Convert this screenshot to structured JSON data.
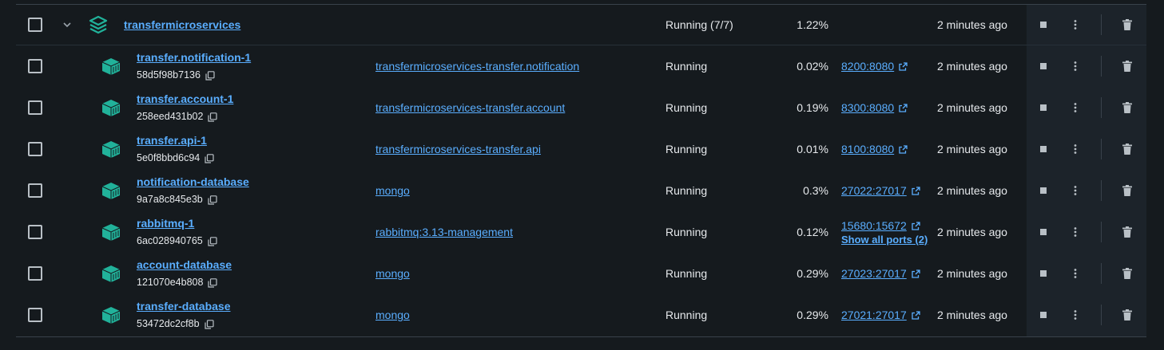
{
  "group": {
    "name": "transfermicroservices",
    "status": "Running (7/7)",
    "cpu": "1.22%",
    "started": "2 minutes ago"
  },
  "containers": [
    {
      "name": "transfer.notification-1",
      "id": "58d5f98b7136",
      "image": "transfermicroservices-transfer.notification",
      "status": "Running",
      "cpu": "0.02%",
      "ports": [
        "8200:8080"
      ],
      "started": "2 minutes ago"
    },
    {
      "name": "transfer.account-1",
      "id": "258eed431b02",
      "image": "transfermicroservices-transfer.account",
      "status": "Running",
      "cpu": "0.19%",
      "ports": [
        "8300:8080"
      ],
      "started": "2 minutes ago"
    },
    {
      "name": "transfer.api-1",
      "id": "5e0f8bbd6c94",
      "image": "transfermicroservices-transfer.api",
      "status": "Running",
      "cpu": "0.01%",
      "ports": [
        "8100:8080"
      ],
      "started": "2 minutes ago"
    },
    {
      "name": "notification-database",
      "id": "9a7a8c845e3b",
      "image": "mongo",
      "status": "Running",
      "cpu": "0.3%",
      "ports": [
        "27022:27017"
      ],
      "started": "2 minutes ago"
    },
    {
      "name": "rabbitmq-1",
      "id": "6ac028940765",
      "image": "rabbitmq:3.13-management",
      "status": "Running",
      "cpu": "0.12%",
      "ports": [
        "15680:15672"
      ],
      "show_all_ports": "Show all ports (2)",
      "started": "2 minutes ago"
    },
    {
      "name": "account-database",
      "id": "121070e4b808",
      "image": "mongo",
      "status": "Running",
      "cpu": "0.29%",
      "ports": [
        "27023:27017"
      ],
      "started": "2 minutes ago"
    },
    {
      "name": "transfer-database",
      "id": "53472dc2cf8b",
      "image": "mongo",
      "status": "Running",
      "cpu": "0.29%",
      "ports": [
        "27021:27017"
      ],
      "started": "2 minutes ago"
    }
  ],
  "icons": {
    "group": "stack-icon",
    "container": "container-icon",
    "copy": "copy-icon",
    "external": "external-link-icon",
    "stop": "stop-icon",
    "menu": "more-vertical-icon",
    "delete": "trash-icon",
    "expand": "chevron-down-icon"
  },
  "colors": {
    "accent_link": "#5aaeff",
    "container_icon": "#21b29a",
    "background": "#151a1e",
    "actions_background": "#1c232a"
  }
}
